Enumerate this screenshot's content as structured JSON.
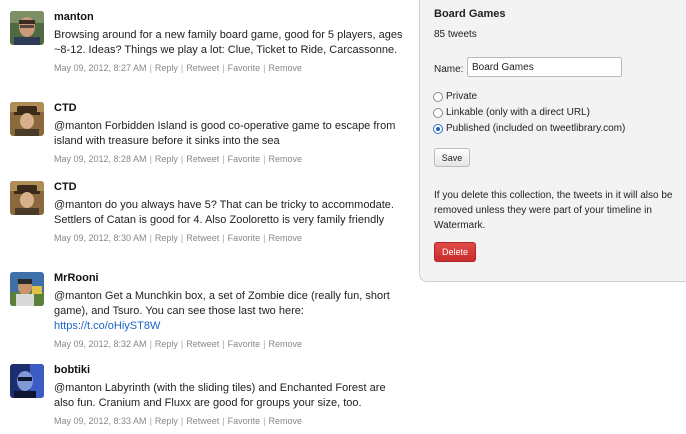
{
  "tweets": [
    {
      "user": "manton",
      "text": "Browsing around for a new family board game, good for 5 players, ages ~8-12. Ideas? Things we play a lot: Clue, Ticket to Ride, Carcassonne.",
      "link": "",
      "date": "May 09, 2012, 8:27 AM",
      "actions": [
        "Reply",
        "Retweet",
        "Favorite",
        "Remove"
      ]
    },
    {
      "user": "CTD",
      "text": "@manton Forbidden Island is good co-operative game to escape from island with treasure before it sinks into the sea",
      "link": "",
      "date": "May 09, 2012, 8:28 AM",
      "actions": [
        "Reply",
        "Retweet",
        "Favorite",
        "Remove"
      ]
    },
    {
      "user": "CTD",
      "text": "@manton do you always have 5? That can be tricky to accommodate. Settlers of Catan is good for 4. Also Zooloretto is very family friendly",
      "link": "",
      "date": "May 09, 2012, 8:30 AM",
      "actions": [
        "Reply",
        "Retweet",
        "Favorite",
        "Remove"
      ]
    },
    {
      "user": "MrRooni",
      "text": "@manton Get a Munchkin box, a set of Zombie dice (really fun, short game), and Tsuro. You can see those last two here:",
      "link": "https://t.co/oHiyST8W",
      "date": "May 09, 2012, 8:32 AM",
      "actions": [
        "Reply",
        "Retweet",
        "Favorite",
        "Remove"
      ]
    },
    {
      "user": "bobtiki",
      "text": "@manton Labyrinth (with the sliding tiles) and Enchanted Forest are also fun. Cranium and Fluxx are good for groups your size, too.",
      "link": "",
      "date": "May 09, 2012, 8:33 AM",
      "actions": [
        "Reply",
        "Retweet",
        "Favorite",
        "Remove"
      ]
    }
  ],
  "panel": {
    "title": "Board Games",
    "count": "85 tweets",
    "name_label": "Name:",
    "name_value": "Board Games",
    "options": [
      {
        "label": "Private",
        "checked": false
      },
      {
        "label": "Linkable (only with a direct URL)",
        "checked": false
      },
      {
        "label": "Published (included on tweetlibrary.com)",
        "checked": true
      }
    ],
    "save_label": "Save",
    "delete_note": "If you delete this collection, the tweets in it will also be removed unless they were part of your timeline in Watermark.",
    "delete_label": "Delete",
    "colors": {
      "delete": "#d13636",
      "link": "#1a66c0",
      "selected": "#1f5fb8"
    }
  }
}
